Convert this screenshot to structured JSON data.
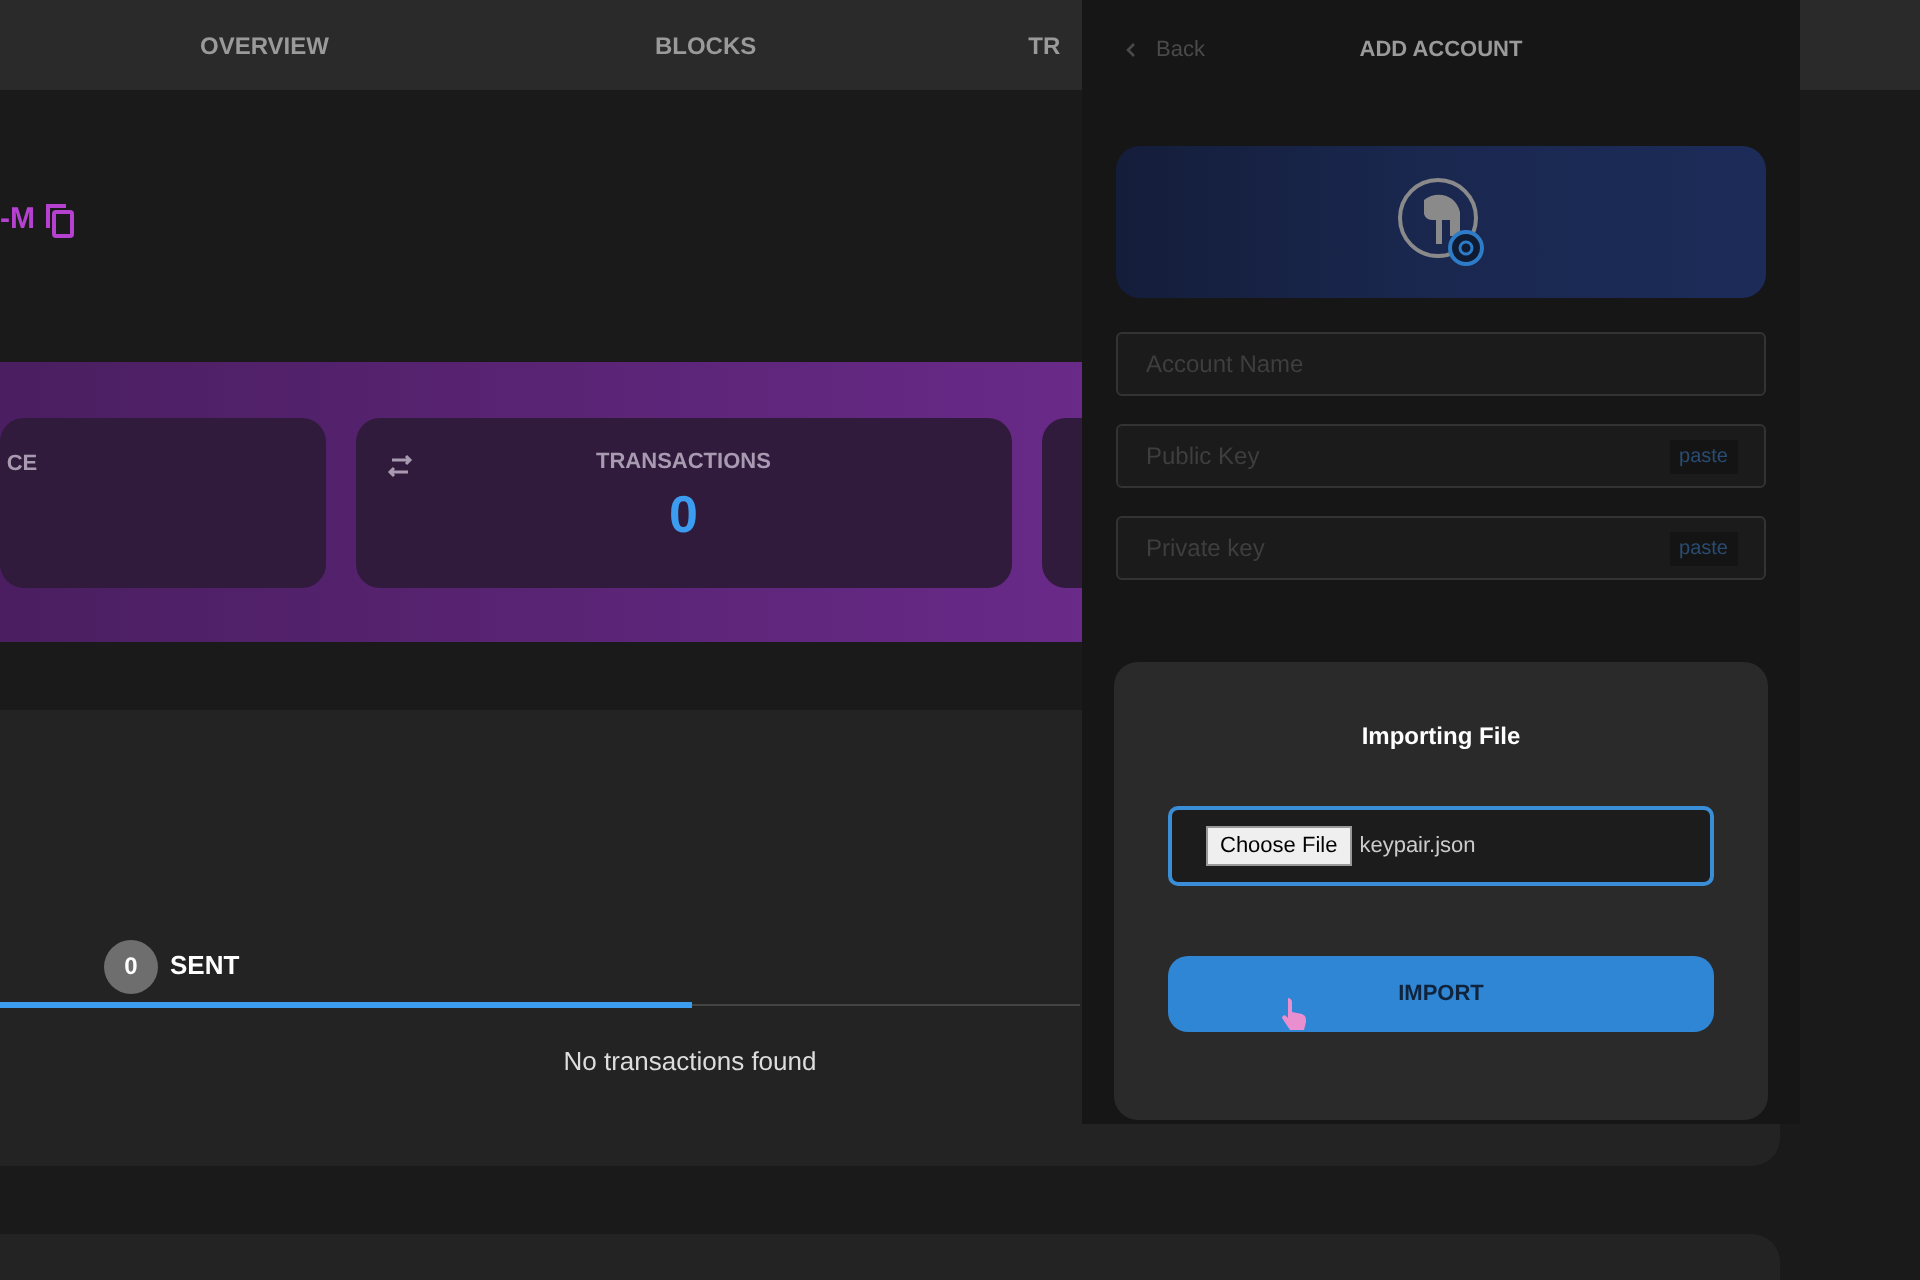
{
  "nav": {
    "items": [
      {
        "label": "OVERVIEW",
        "selected": false
      },
      {
        "label": "BLOCKS",
        "selected": false
      },
      {
        "label": "TR",
        "selected": false
      }
    ]
  },
  "address": {
    "text": "-M"
  },
  "stats": [
    {
      "label": "CE"
    },
    {
      "label": "TRANSACTIONS",
      "value": "0"
    }
  ],
  "transactions": {
    "tabs": [
      {
        "count": "0",
        "label": "SENT",
        "selected": false
      }
    ],
    "tab_indicator": {
      "level": 0.64
    },
    "empty_text": "No transactions found"
  },
  "add_account": {
    "back": "Back",
    "title": "ADD ACCOUNT",
    "fields": [
      {
        "placeholder": "Account Name"
      },
      {
        "placeholder": "Public Key",
        "action": "paste"
      },
      {
        "placeholder": "Private key",
        "action": "paste"
      }
    ]
  },
  "import_dialog": {
    "title": "Importing File",
    "file_button": "Choose File",
    "file_name": "keypair.json",
    "submit": "IMPORT"
  }
}
